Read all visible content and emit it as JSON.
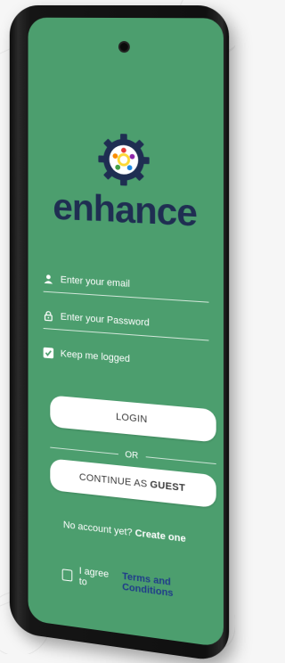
{
  "app": {
    "brand": "enhance"
  },
  "form": {
    "email_placeholder": "Enter your email",
    "password_placeholder": "Enter your Password",
    "keep_logged_label": "Keep me logged",
    "keep_logged_checked": true
  },
  "buttons": {
    "login": "LOGIN",
    "or": "OR",
    "continue_as": "CONTINUE AS",
    "guest": "GUEST"
  },
  "signup": {
    "prompt": "No account yet?",
    "link": "Create one"
  },
  "terms": {
    "prefix": "I agree to",
    "link": "Terms and Conditions",
    "checked": false
  },
  "colors": {
    "screen_bg": "#4c9e6e",
    "brand": "#1f2e52",
    "link": "#1f3b8a"
  },
  "icons": {
    "email": "person-icon",
    "password": "lock-icon",
    "keep_logged": "checkbox-checked-icon",
    "terms": "checkbox-empty-icon"
  }
}
